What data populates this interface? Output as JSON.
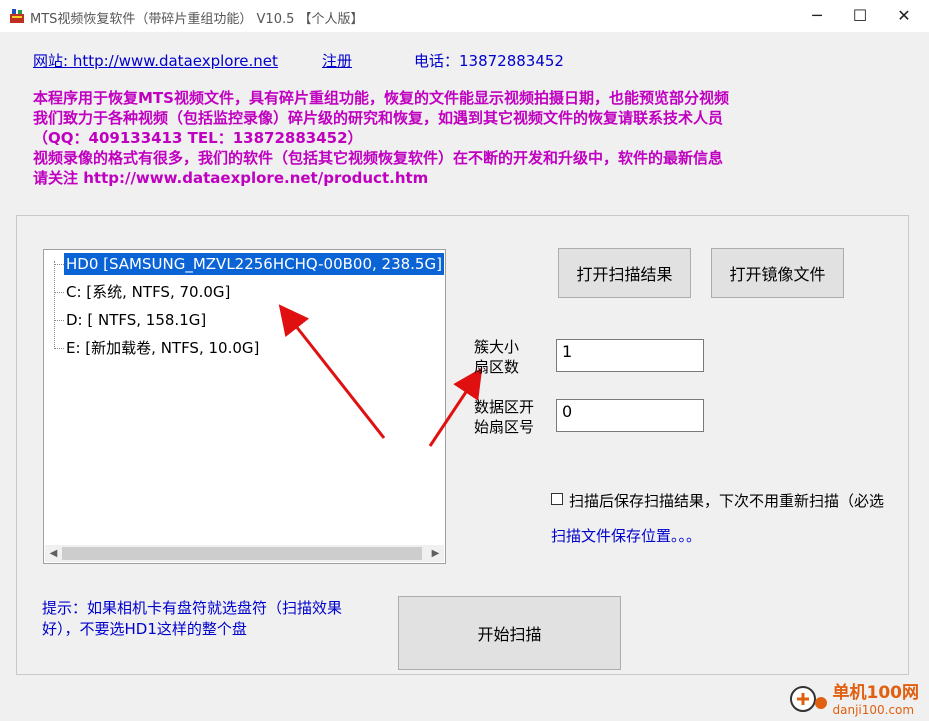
{
  "window": {
    "title": "MTS视频恢复软件（带碎片重组功能） V10.5 【个人版】",
    "minimize_glyph": "─",
    "maximize_glyph": "☐",
    "close_glyph": "✕"
  },
  "header": {
    "website_label": "网站: http://www.dataexplore.net",
    "register_label": "注册",
    "phone_label": "电话：13872883452"
  },
  "info": {
    "lines": [
      "本程序用于恢复MTS视频文件，具有碎片重组功能，恢复的文件能显示视频拍摄日期，也能预览部分视频",
      "我们致力于各种视频（包括监控录像）碎片级的研究和恢复，如遇到其它视频文件的恢复请联系技术人员",
      "（QQ：409133413  TEL：13872883452）",
      "视频录像的格式有很多，我们的软件（包括其它视频恢复软件）在不断的开发和升级中，软件的最新信息",
      "请关注 http://www.dataexplore.net/product.htm"
    ]
  },
  "tree": {
    "items": [
      {
        "label": "HD0  [SAMSUNG_MZVL2256HCHQ-00B00, 238.5G]",
        "selected": true
      },
      {
        "label": "C:  [系统, NTFS, 70.0G]",
        "selected": false
      },
      {
        "label": "D:  [ NTFS, 158.1G]",
        "selected": false
      },
      {
        "label": "E:  [新加载卷, NTFS, 10.0G]",
        "selected": false
      }
    ],
    "scroll_left": "◀",
    "scroll_right": "▶"
  },
  "buttons": {
    "open_scan_result": "打开扫描结果",
    "open_image_file": "打开镜像文件",
    "start_scan": "开始扫描"
  },
  "fields": {
    "cluster_label_1": "簇大小",
    "cluster_label_2": "扇区数",
    "cluster_value": "1",
    "data_start_label_1": "数据区开",
    "data_start_label_2": "始扇区号",
    "data_start_value": "0"
  },
  "options": {
    "save_checkbox_label": "扫描后保存扫描结果，下次不用重新扫描（必选",
    "save_location_link": "扫描文件保存位置。。。"
  },
  "hint": {
    "line1": "提示：如果相机卡有盘符就选盘符（扫描效果",
    "line2": "好），不要选HD1这样的整个盘"
  },
  "watermark": {
    "site_cn": "单机100网",
    "site_url": "danji100.com"
  },
  "colors": {
    "accent_magenta": "#c000c0",
    "link_blue": "#0000cc",
    "selection": "#0a64d6",
    "arrow_red": "#e01010"
  }
}
